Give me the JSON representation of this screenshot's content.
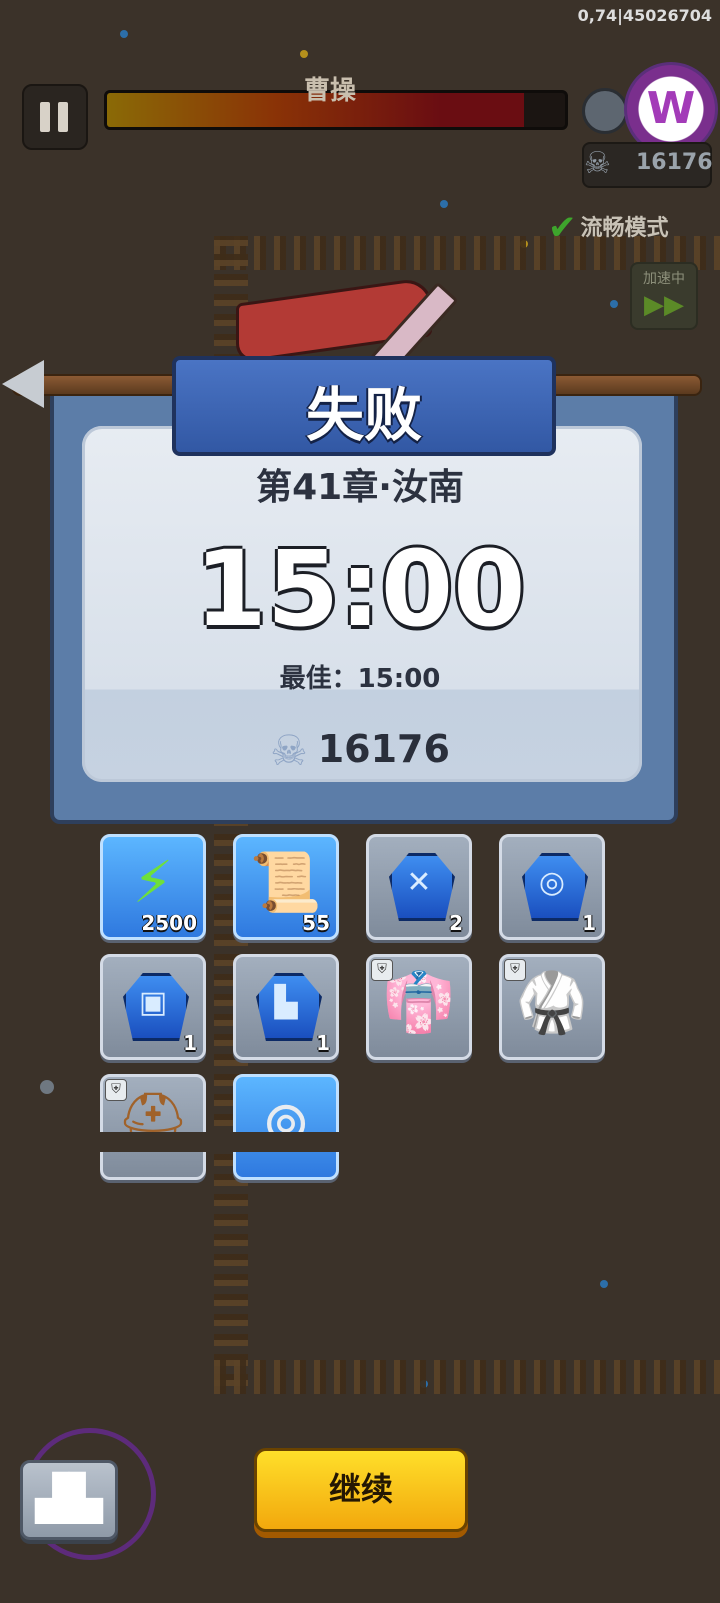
{
  "debug_label": "0,74|45026704",
  "boss": {
    "name": "曹操",
    "hp_fraction": 0.91
  },
  "skull_count_hud": "16176",
  "smooth_mode_label": "流畅模式",
  "speed_button_label": "加速中",
  "result": {
    "title": "失败",
    "chapter": "第41章·汝南",
    "time": "15:00",
    "best": "最佳：15:00",
    "kills": "16176"
  },
  "rewards": [
    {
      "icon": "energy-bolt-icon",
      "count": "2500",
      "style": "blue"
    },
    {
      "icon": "map-scroll-icon",
      "count": "55",
      "style": "blue"
    },
    {
      "icon": "sword-gem-icon",
      "count": "2",
      "style": "gray"
    },
    {
      "icon": "medal-gem-icon",
      "count": "1",
      "style": "gray"
    },
    {
      "icon": "armor-gem-icon",
      "count": "1",
      "style": "gray"
    },
    {
      "icon": "boot-gem-icon",
      "count": "1",
      "style": "gray"
    },
    {
      "icon": "red-armor-icon",
      "count": "",
      "style": "gray"
    },
    {
      "icon": "purple-armor-icon",
      "count": "",
      "style": "gray"
    },
    {
      "icon": "helmet-icon",
      "count": "",
      "style": "gray"
    },
    {
      "icon": "silver-coin-icon",
      "count": "",
      "style": "blue"
    }
  ],
  "continue_label": "继续",
  "colors": {
    "panel_blue": "#5c7da8",
    "button_yellow": "#f7c51c",
    "background": "#3b3229"
  }
}
